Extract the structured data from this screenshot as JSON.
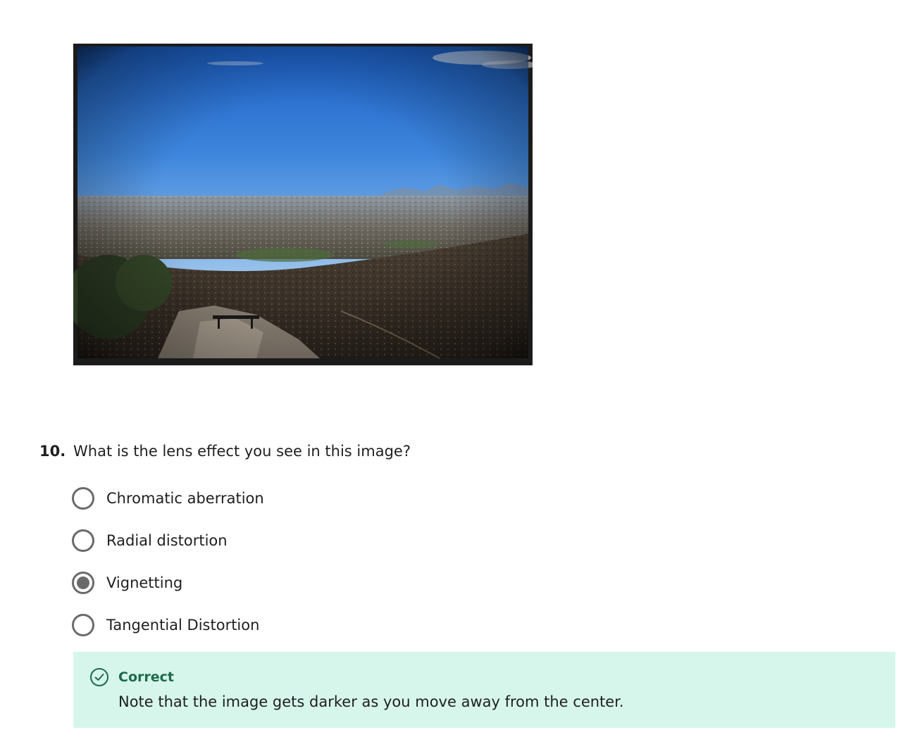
{
  "photo": {
    "icon": "landscape-photo"
  },
  "question": {
    "number": "10.",
    "text": "What is the lens effect you see in this image?"
  },
  "options": [
    {
      "label": "Chromatic aberration",
      "selected": false
    },
    {
      "label": "Radial distortion",
      "selected": false
    },
    {
      "label": "Vignetting",
      "selected": true
    },
    {
      "label": "Tangential Distortion",
      "selected": false
    }
  ],
  "feedback": {
    "icon": "check-circle-icon",
    "title": "Correct",
    "text": "Note that the image gets darker as you move away from the center.",
    "color": "#1d6b4a",
    "background": "#d6f6ec"
  }
}
